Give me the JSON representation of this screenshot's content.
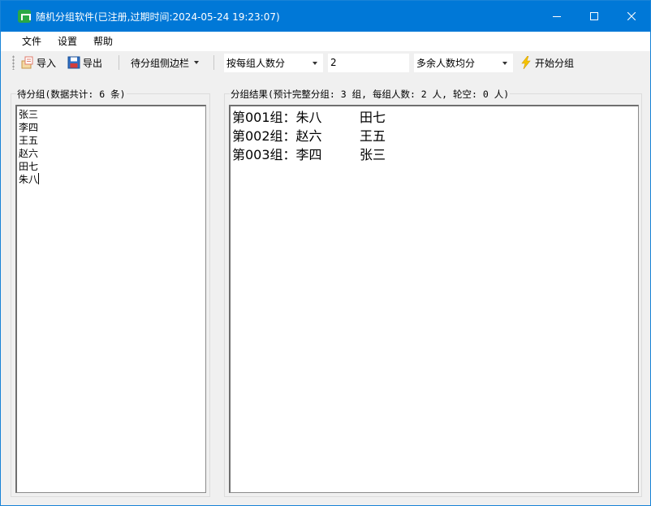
{
  "window": {
    "title": "随机分组软件(已注册,过期时间:2024-05-24 19:23:07)"
  },
  "menu": {
    "items": [
      "文件",
      "设置",
      "帮助"
    ]
  },
  "toolbar": {
    "import_label": "导入",
    "export_label": "导出",
    "sidebar_dropdown_label": "待分组侧边栏",
    "group_mode": "按每组人数分",
    "group_count_value": "2",
    "remainder_mode": "多余人数均分",
    "start_label": "开始分组"
  },
  "left_panel": {
    "label": "待分组(数据共计: 6 条)",
    "names": [
      "张三",
      "李四",
      "王五",
      "赵六",
      "田七",
      "朱八"
    ]
  },
  "right_panel": {
    "label": "分组结果(预计完整分组: 3 组, 每组人数: 2 人, 轮空: 0 人)",
    "results": [
      {
        "group": "第001组：朱八",
        "member": "田七"
      },
      {
        "group": "第002组：赵六",
        "member": "王五"
      },
      {
        "group": "第003组：李四",
        "member": "张三"
      }
    ]
  },
  "colors": {
    "titlebar": "#0078d7",
    "app_icon": "#2aa845",
    "start_icon": "#f5c400"
  }
}
